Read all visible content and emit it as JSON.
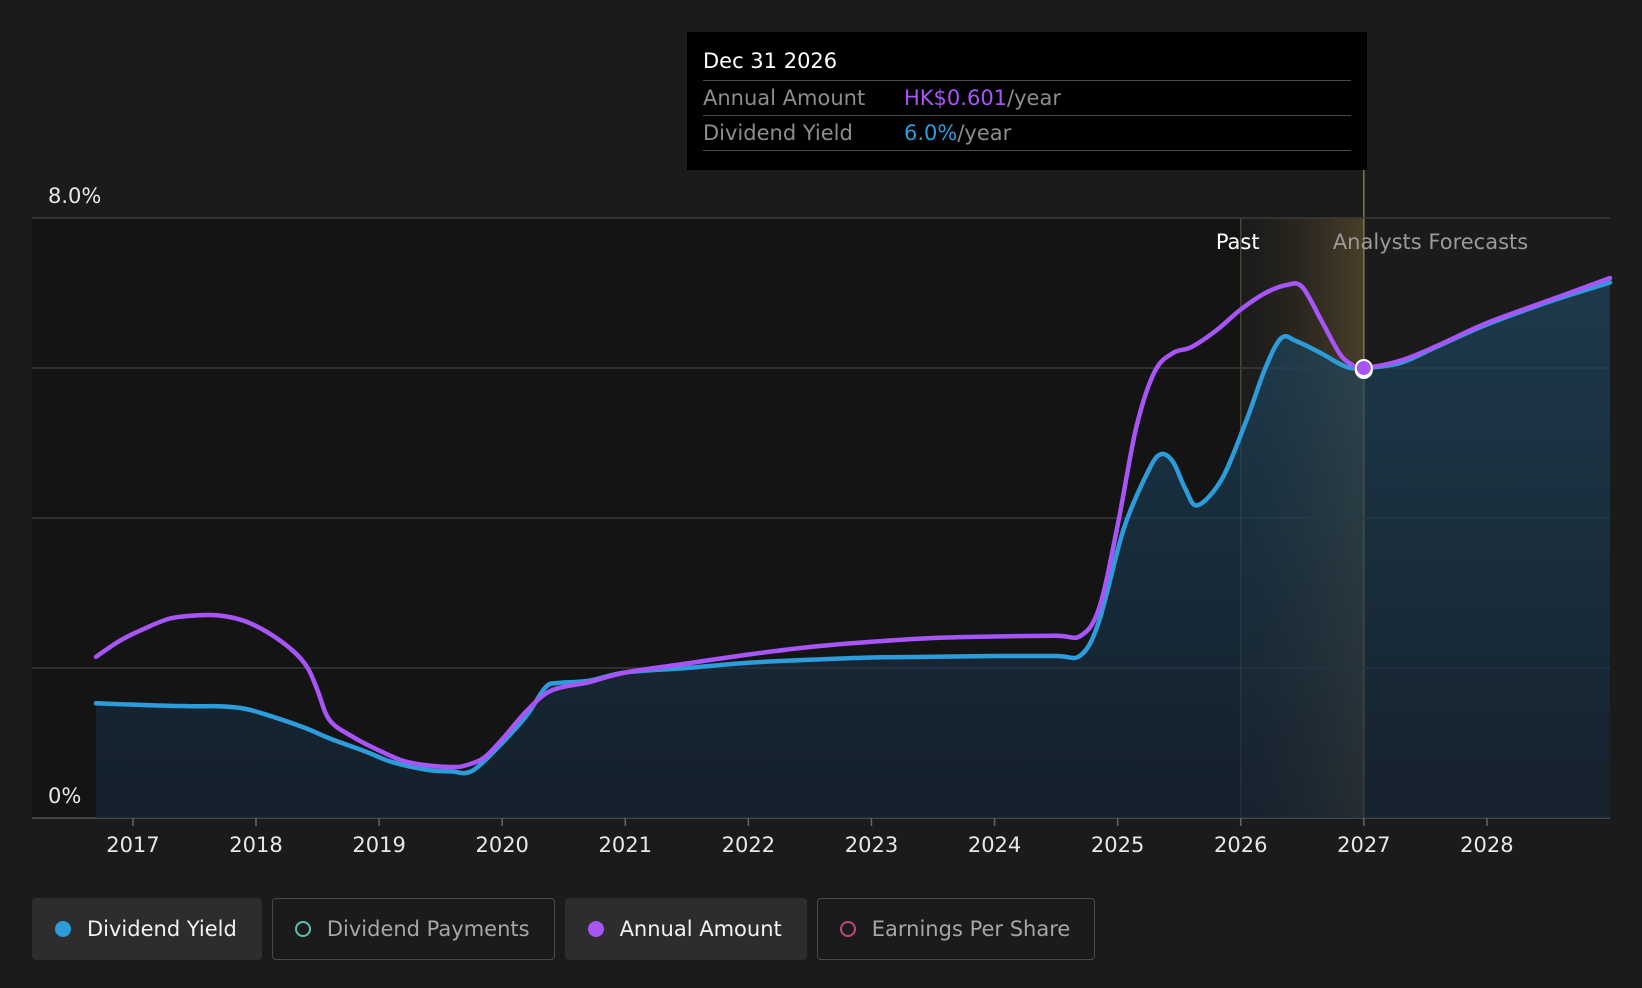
{
  "tooltip": {
    "date": "Dec 31 2026",
    "rows": [
      {
        "label": "Annual Amount",
        "value": "HK$0.601",
        "unit": "/year",
        "color": "#a855f7"
      },
      {
        "label": "Dividend Yield",
        "value": "6.0%",
        "unit": "/year",
        "color": "#2d9cdb"
      }
    ]
  },
  "legend": [
    {
      "label": "Dividend Yield",
      "color": "#2d9cdb",
      "filled": true,
      "active": true
    },
    {
      "label": "Dividend Payments",
      "color": "#5fbfb0",
      "filled": false,
      "active": false
    },
    {
      "label": "Annual Amount",
      "color": "#a855f7",
      "filled": true,
      "active": true
    },
    {
      "label": "Earnings Per Share",
      "color": "#c0457f",
      "filled": false,
      "active": false
    }
  ],
  "chart_data": {
    "type": "line",
    "xlim": [
      2016.18,
      2029.0
    ],
    "ylim": [
      0,
      8
    ],
    "y_ticks": [
      0,
      2,
      4,
      6,
      8
    ],
    "y_tick_labels": {
      "0": "0%",
      "8": "8.0%"
    },
    "x_tick_labels": [
      "2017",
      "2018",
      "2019",
      "2020",
      "2021",
      "2022",
      "2023",
      "2024",
      "2025",
      "2026",
      "2027",
      "2028"
    ],
    "past_label": "Past",
    "forecast_label": "Analysts Forecasts",
    "past_start": 2026.0,
    "forecast_start": 2027.0,
    "highlight_point": {
      "x": 2027.0,
      "y": 6.0
    },
    "series": [
      {
        "name": "Dividend Yield",
        "color": "#2d9cdb",
        "fill": true,
        "points": [
          [
            2016.7,
            1.53
          ],
          [
            2017.2,
            1.5
          ],
          [
            2017.5,
            1.49
          ],
          [
            2017.7,
            1.49
          ],
          [
            2017.9,
            1.46
          ],
          [
            2018.1,
            1.37
          ],
          [
            2018.4,
            1.2
          ],
          [
            2018.6,
            1.06
          ],
          [
            2018.9,
            0.88
          ],
          [
            2019.1,
            0.75
          ],
          [
            2019.4,
            0.64
          ],
          [
            2019.6,
            0.62
          ],
          [
            2019.7,
            0.6
          ],
          [
            2019.8,
            0.68
          ],
          [
            2020.0,
            1.0
          ],
          [
            2020.2,
            1.37
          ],
          [
            2020.35,
            1.74
          ],
          [
            2020.45,
            1.8
          ],
          [
            2020.7,
            1.83
          ],
          [
            2021.0,
            1.94
          ],
          [
            2021.5,
            2.0
          ],
          [
            2022.0,
            2.07
          ],
          [
            2022.5,
            2.11
          ],
          [
            2023.0,
            2.14
          ],
          [
            2023.5,
            2.15
          ],
          [
            2024.0,
            2.16
          ],
          [
            2024.5,
            2.16
          ],
          [
            2024.7,
            2.17
          ],
          [
            2024.85,
            2.63
          ],
          [
            2025.05,
            3.86
          ],
          [
            2025.25,
            4.63
          ],
          [
            2025.35,
            4.85
          ],
          [
            2025.45,
            4.75
          ],
          [
            2025.55,
            4.39
          ],
          [
            2025.65,
            4.17
          ],
          [
            2025.85,
            4.53
          ],
          [
            2026.05,
            5.32
          ],
          [
            2026.2,
            6.0
          ],
          [
            2026.33,
            6.4
          ],
          [
            2026.45,
            6.36
          ],
          [
            2026.65,
            6.2
          ],
          [
            2026.85,
            6.02
          ],
          [
            2027.0,
            6.0
          ],
          [
            2027.3,
            6.07
          ],
          [
            2027.6,
            6.29
          ],
          [
            2028.0,
            6.58
          ],
          [
            2028.5,
            6.88
          ],
          [
            2029.0,
            7.14
          ]
        ]
      },
      {
        "name": "Annual Amount",
        "color": "#a855f7",
        "fill": false,
        "points": [
          [
            2016.7,
            2.15
          ],
          [
            2016.9,
            2.37
          ],
          [
            2017.1,
            2.53
          ],
          [
            2017.3,
            2.66
          ],
          [
            2017.5,
            2.7
          ],
          [
            2017.7,
            2.7
          ],
          [
            2017.9,
            2.63
          ],
          [
            2018.1,
            2.47
          ],
          [
            2018.3,
            2.23
          ],
          [
            2018.42,
            2.0
          ],
          [
            2018.5,
            1.7
          ],
          [
            2018.6,
            1.3
          ],
          [
            2018.8,
            1.07
          ],
          [
            2019.0,
            0.9
          ],
          [
            2019.2,
            0.76
          ],
          [
            2019.4,
            0.7
          ],
          [
            2019.6,
            0.68
          ],
          [
            2019.7,
            0.7
          ],
          [
            2019.85,
            0.8
          ],
          [
            2020.0,
            1.05
          ],
          [
            2020.2,
            1.43
          ],
          [
            2020.4,
            1.7
          ],
          [
            2020.7,
            1.81
          ],
          [
            2021.0,
            1.94
          ],
          [
            2021.5,
            2.06
          ],
          [
            2022.0,
            2.18
          ],
          [
            2022.5,
            2.28
          ],
          [
            2023.0,
            2.35
          ],
          [
            2023.5,
            2.4
          ],
          [
            2024.0,
            2.42
          ],
          [
            2024.5,
            2.43
          ],
          [
            2024.7,
            2.43
          ],
          [
            2024.85,
            2.8
          ],
          [
            2025.0,
            3.9
          ],
          [
            2025.15,
            5.2
          ],
          [
            2025.3,
            5.95
          ],
          [
            2025.45,
            6.2
          ],
          [
            2025.6,
            6.28
          ],
          [
            2025.8,
            6.5
          ],
          [
            2026.0,
            6.78
          ],
          [
            2026.2,
            7.0
          ],
          [
            2026.38,
            7.11
          ],
          [
            2026.5,
            7.08
          ],
          [
            2026.65,
            6.65
          ],
          [
            2026.8,
            6.2
          ],
          [
            2026.9,
            6.05
          ],
          [
            2027.0,
            6.0
          ],
          [
            2027.3,
            6.1
          ],
          [
            2027.6,
            6.3
          ],
          [
            2028.0,
            6.6
          ],
          [
            2028.5,
            6.9
          ],
          [
            2029.0,
            7.2
          ]
        ]
      }
    ]
  }
}
